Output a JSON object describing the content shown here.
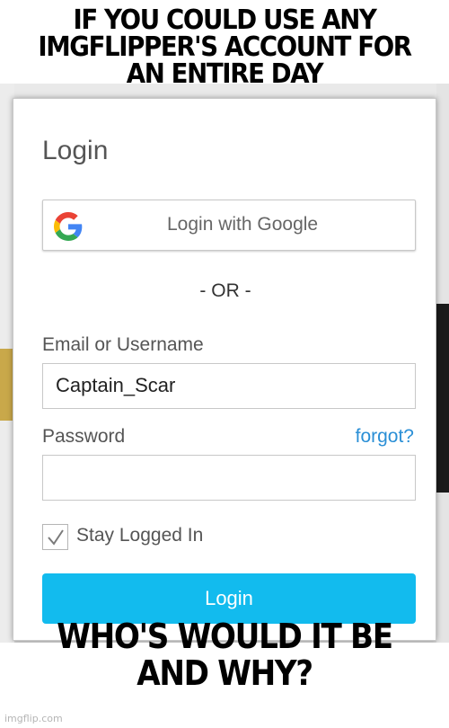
{
  "meme": {
    "top_caption": "IF YOU COULD USE ANY IMGFLIPPER'S ACCOUNT FOR AN ENTIRE DAY",
    "bottom_caption": "WHO'S WOULD IT BE AND WHY?",
    "watermark": "imgflip.com"
  },
  "login": {
    "title": "Login",
    "google_button_label": "Login with Google",
    "or_divider": "- OR -",
    "email_label": "Email or Username",
    "email_value": "Captain_Scar",
    "password_label": "Password",
    "password_value": "",
    "forgot_link": "forgot?",
    "stay_logged_in_label": "Stay Logged In",
    "stay_logged_in_checked": true,
    "submit_label": "Login"
  },
  "colors": {
    "accent_blue": "#12bbee",
    "link_blue": "#2a8fd6",
    "google_blue": "#4285F4",
    "google_red": "#EA4335",
    "google_yellow": "#FBBC05",
    "google_green": "#34A853"
  },
  "icons": {
    "google": "google-g-icon",
    "check": "checkmark-icon"
  }
}
